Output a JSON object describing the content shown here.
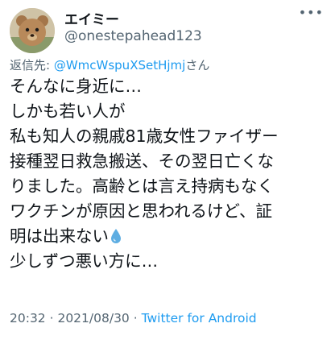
{
  "user": {
    "display_name": "エイミー",
    "handle": "@onestepahead123",
    "avatar_icon": "teddy-bear-avatar"
  },
  "more_icon": "more-options-icon",
  "reply": {
    "prefix": "返信先: ",
    "mention": "@WmcWspuXSetHjmj",
    "suffix": "さん"
  },
  "tweet": {
    "lines": [
      "そんなに身近に…",
      "しかも若い人が",
      "私も知人の親戚81歳女性ファイザー",
      "接種翌日救急搬送、その翌日亡くな",
      "りました。高齢とは言え持病もなく",
      "ワクチンが原因と思われるけど、証",
      "明は出来ない",
      "少しずつ悪い方に…"
    ],
    "emoji": "droplet-icon"
  },
  "meta": {
    "time": "20:32",
    "separator": " · ",
    "date": "2021/08/30",
    "separator2": " · ",
    "source": "Twitter for Android"
  },
  "colors": {
    "link": "#1d9bf0",
    "secondary": "#536471",
    "text": "#0f1419"
  }
}
